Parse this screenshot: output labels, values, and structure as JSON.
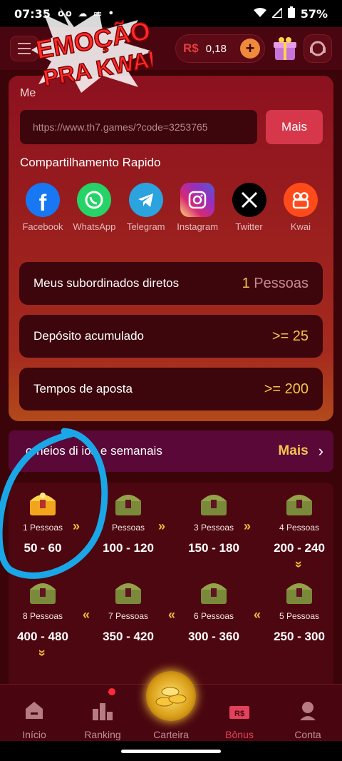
{
  "status_bar": {
    "time": "07:35",
    "battery": "57%"
  },
  "overlay": {
    "line1": "EMOÇÃO",
    "line2": "PRA KWAI"
  },
  "header": {
    "currency": "R$",
    "balance": "0,18"
  },
  "invite": {
    "title": "Me",
    "link": "https://www.th7.games/?code=3253765",
    "more_label": "Mais",
    "share_title": "Compartilhamento Rapido",
    "share": [
      {
        "label": "Facebook",
        "icon": "facebook-icon",
        "color": "#1877f2"
      },
      {
        "label": "WhatsApp",
        "icon": "whatsapp-icon",
        "color": "#25d366"
      },
      {
        "label": "Telegram",
        "icon": "telegram-icon",
        "color": "#2aa3df"
      },
      {
        "label": "Instagram",
        "icon": "instagram-icon",
        "color": "#d62976"
      },
      {
        "label": "Twitter",
        "icon": "x-icon",
        "color": "#000000"
      },
      {
        "label": "Kwai",
        "icon": "kwai-icon",
        "color": "#ff5a1f"
      }
    ]
  },
  "stats": [
    {
      "label": "Meus subordinados diretos",
      "value": "1",
      "unit": "Pessoas"
    },
    {
      "label": "Depósito acumulado",
      "value": ">= 25"
    },
    {
      "label": "Tempos de aposta",
      "value": ">= 200"
    }
  ],
  "tournament": {
    "label": "Torneios diários e semanais",
    "visible_label": "orneios di    ios e semanais",
    "more": "Mais"
  },
  "tiers": [
    {
      "people": "1 Pessoas",
      "range": "50 - 60",
      "state": "active"
    },
    {
      "people": "Pessoas",
      "range": "100 - 120",
      "state": "locked"
    },
    {
      "people": "3 Pessoas",
      "range": "150 - 180",
      "state": "locked"
    },
    {
      "people": "4 Pessoas",
      "range": "200 - 240",
      "state": "locked"
    },
    {
      "people": "5 Pessoas",
      "range": "250 - 300",
      "state": "locked"
    },
    {
      "people": "6 Pessoas",
      "range": "300 - 360",
      "state": "locked"
    },
    {
      "people": "7 Pessoas",
      "range": "350 - 420",
      "state": "locked"
    },
    {
      "people": "8 Pessoas",
      "range": "400 - 480",
      "state": "locked"
    }
  ],
  "nav": [
    {
      "label": "Início",
      "icon": "home-icon"
    },
    {
      "label": "Ranking",
      "icon": "ranking-icon"
    },
    {
      "label": "Carteira",
      "icon": "wallet-icon"
    },
    {
      "label": "Bônus",
      "icon": "bonus-icon",
      "active": true
    },
    {
      "label": "Conta",
      "icon": "account-icon"
    }
  ]
}
